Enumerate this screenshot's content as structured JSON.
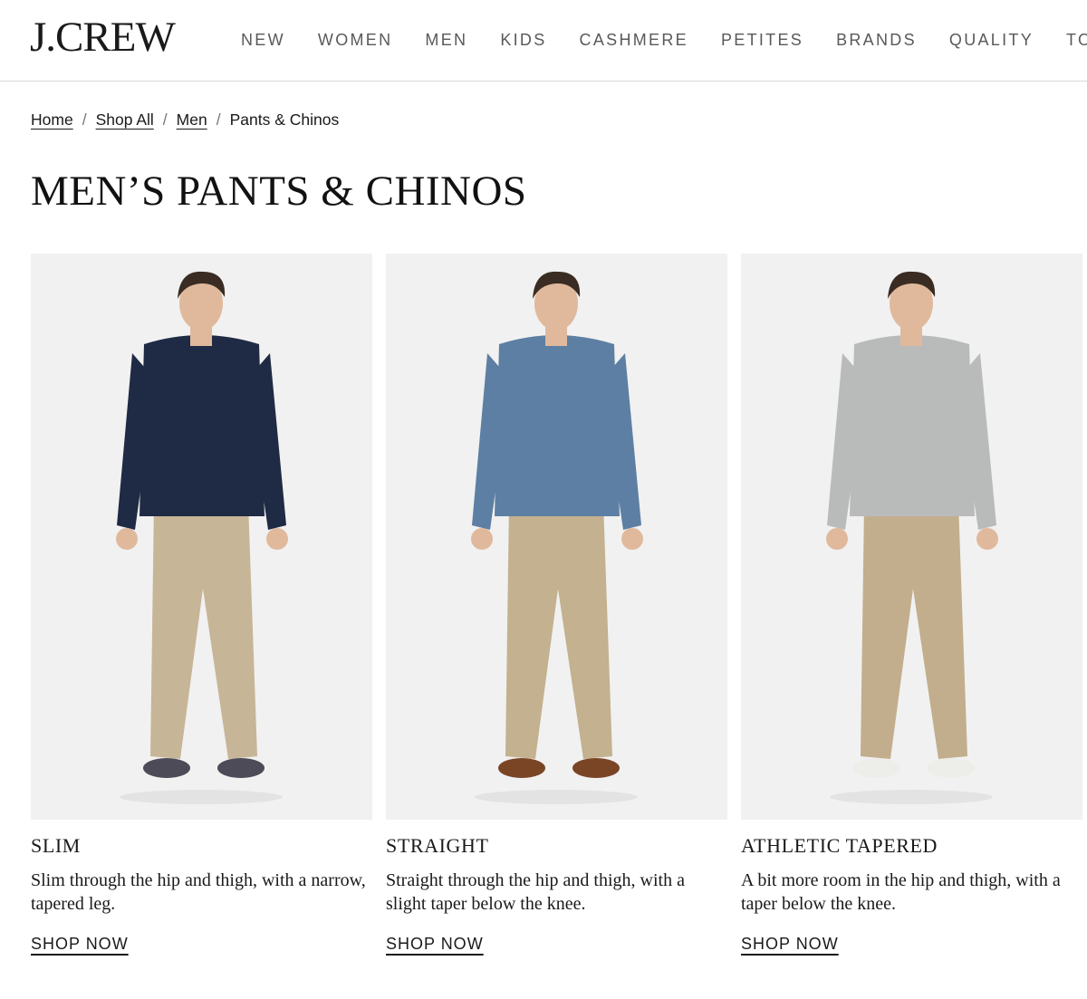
{
  "header": {
    "logo": "J.CREW",
    "nav": [
      "NEW",
      "WOMEN",
      "MEN",
      "KIDS",
      "CASHMERE",
      "PETITES",
      "BRANDS",
      "QUALITY",
      "TOP"
    ]
  },
  "breadcrumb": {
    "items": [
      "Home",
      "Shop All",
      "Men"
    ],
    "current": "Pants & Chinos"
  },
  "page_title": "MEN’S PANTS & CHINOS",
  "products": [
    {
      "title": "SLIM",
      "description": "Slim through the hip and thigh, with a narrow, tapered leg.",
      "cta": "SHOP NOW",
      "colors": {
        "top": "#1f2a44",
        "pants": "#c7b597",
        "shoes": "#4e4b58"
      }
    },
    {
      "title": "STRAIGHT",
      "description": "Straight through the hip and thigh, with a slight taper below the knee.",
      "cta": "SHOP NOW",
      "colors": {
        "top": "#5d7fa3",
        "pants": "#c3b18f",
        "shoes": "#7a4525"
      }
    },
    {
      "title": "ATHLETIC TAPERED",
      "description": "A bit more room in the hip and thigh, with a taper below the knee.",
      "cta": "SHOP NOW",
      "colors": {
        "top": "#b9bbbb",
        "pants": "#c2ae8d",
        "shoes": "#ededea"
      }
    }
  ]
}
